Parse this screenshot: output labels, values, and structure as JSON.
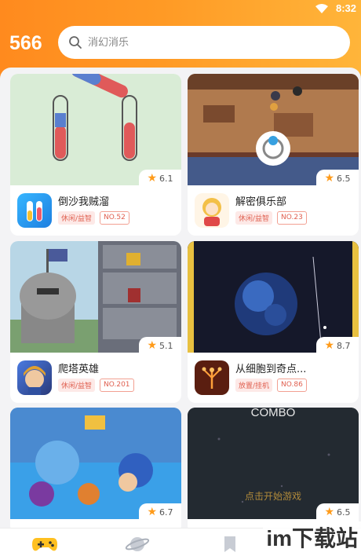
{
  "status": {
    "time": "8:32"
  },
  "header": {
    "logo": "566"
  },
  "search": {
    "placeholder": "消幻消乐"
  },
  "games": [
    {
      "name": "倒沙我贼溜",
      "tags": [
        "休闲/益智",
        "NO.52"
      ],
      "rating": "6.1"
    },
    {
      "name": "解密俱乐部",
      "tags": [
        "休闲/益智",
        "NO.23"
      ],
      "rating": "6.5"
    },
    {
      "name": "爬塔英雄",
      "tags": [
        "休闲/益智",
        "NO.201"
      ],
      "rating": "5.1"
    },
    {
      "name": "从细胞到奇点...",
      "tags": [
        "放置/挂机",
        "NO.86"
      ],
      "rating": "8.7"
    },
    {
      "name": "",
      "tags": [],
      "rating": "6.7"
    },
    {
      "name": "",
      "tags": [],
      "rating": "6.5",
      "overlay_top": "COMBO",
      "overlay_center": "点击开始游戏"
    }
  ],
  "nav": {
    "items": [
      "gamepad-icon",
      "planet-icon",
      "bookmark-icon"
    ]
  },
  "watermark": "im下载站"
}
